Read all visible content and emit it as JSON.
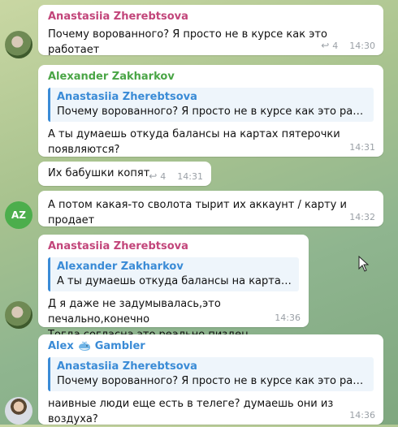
{
  "messages": [
    {
      "author": "Anastasiia Zherebtsova",
      "author_color": "#c2457a",
      "text": "Почему ворованного? Я просто не в курсе как это работает",
      "replies": "4",
      "time": "14:30"
    },
    {
      "author": "Alexander Zakharkov",
      "author_color": "#4aa546",
      "reply_to": {
        "name": "Anastasiia Zherebtsova",
        "text": "Почему ворованного? Я просто не в курсе как это работает"
      },
      "text_line1": "А ты думаешь откуда балансы на картах пятерочки",
      "text_line2": "появляются?",
      "time": "14:31"
    },
    {
      "text": "Их бабушки копят",
      "replies": "4",
      "time": "14:31"
    },
    {
      "avatar_initials": "AZ",
      "text": "А потом какая-то сволота тырит их аккаунт / карту и продает",
      "time": "14:32"
    },
    {
      "author": "Anastasiia Zherebtsova",
      "author_color": "#c2457a",
      "reply_to": {
        "name": "Alexander Zakharkov",
        "text": "А ты думаешь откуда балансы на картах пяте..."
      },
      "text_line1": "Д я даже не задумывалась,это печально,конечно",
      "text_line2": "Тогда согласна,это реально пиздец",
      "time": "14:36"
    },
    {
      "author_name": "Alex",
      "author_suffix": "Gambler",
      "author_color": "#3a8bd6",
      "reply_to": {
        "name": "Anastasiia Zherebtsova",
        "text": "Почему ворованного? Я просто не в курсе как это работает"
      },
      "text": "наивные люди еще есть в телеге?  думаешь они из воздуха?",
      "time": "14:36"
    }
  ]
}
